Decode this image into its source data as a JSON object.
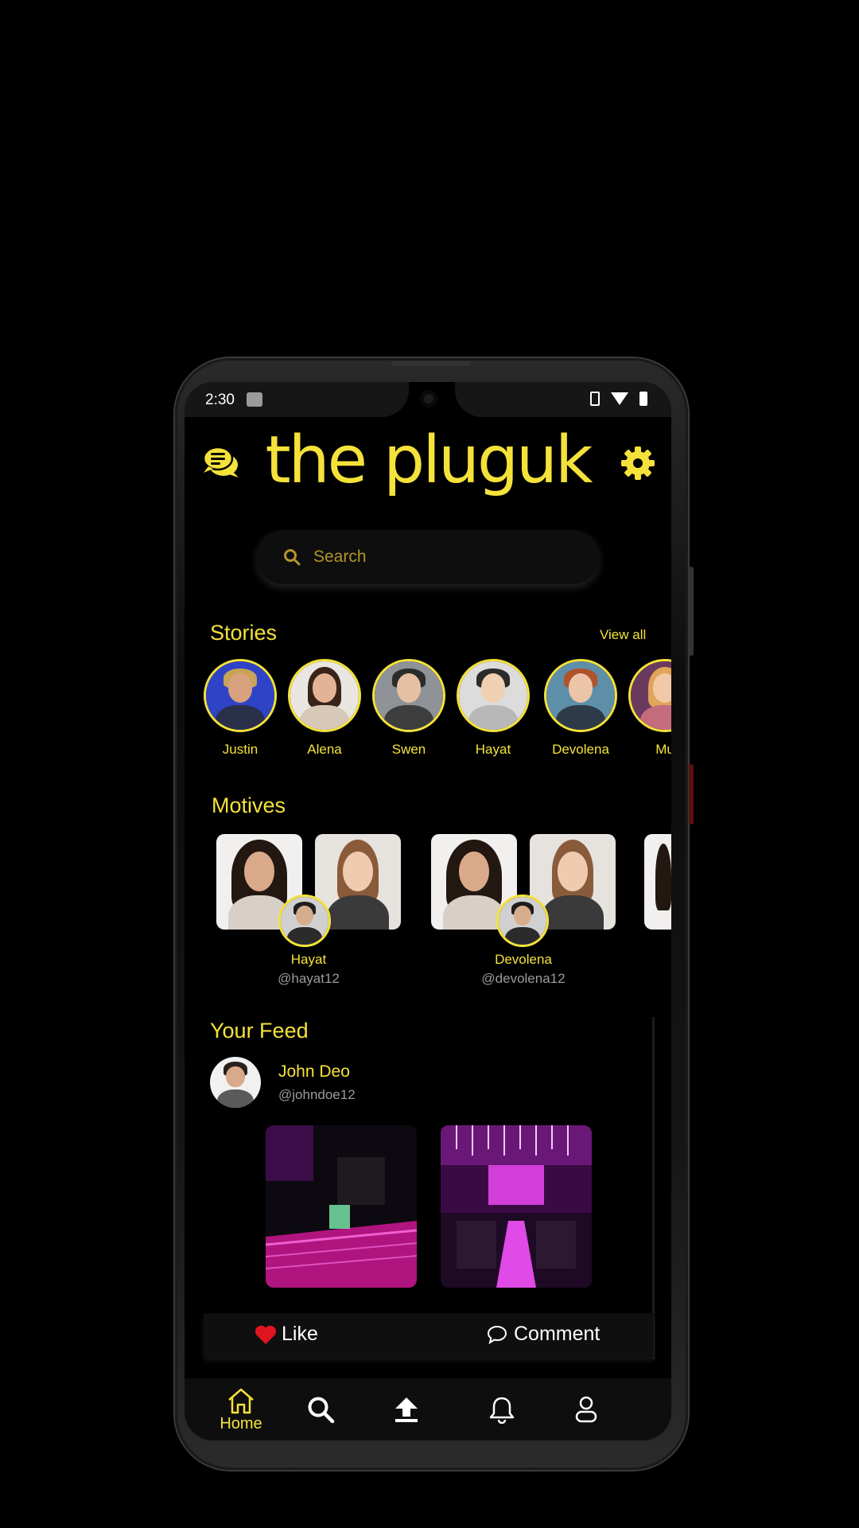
{
  "status_bar": {
    "time": "2:30"
  },
  "app": {
    "title": "the pluguk"
  },
  "search": {
    "placeholder": "Search"
  },
  "stories": {
    "title": "Stories",
    "view_all": "View all",
    "items": [
      {
        "name": "Justin"
      },
      {
        "name": "Alena"
      },
      {
        "name": "Swen"
      },
      {
        "name": "Hayat"
      },
      {
        "name": "Devolena"
      },
      {
        "name": "Mu"
      }
    ]
  },
  "motives": {
    "title": "Motives",
    "items": [
      {
        "name": "Hayat",
        "handle": "@hayat12"
      },
      {
        "name": "Devolena",
        "handle": "@devolena12"
      }
    ]
  },
  "feed": {
    "title": "Your Feed",
    "post": {
      "user": "John Deo",
      "handle": "@johndoe12"
    },
    "like_label": "Like",
    "comment_label": "Comment"
  },
  "bottom_nav": {
    "home_label": "Home"
  },
  "colors": {
    "accent": "#f4e23a",
    "background": "#000000",
    "like": "#e0141e"
  }
}
